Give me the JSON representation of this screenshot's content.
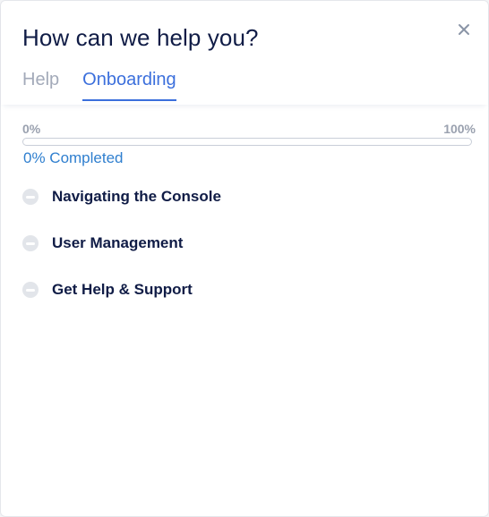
{
  "dialog": {
    "title": "How can we help you?",
    "close_icon": "close-icon"
  },
  "tabs": [
    {
      "label": "Help",
      "active": false
    },
    {
      "label": "Onboarding",
      "active": true
    }
  ],
  "progress": {
    "min_label": "0%",
    "max_label": "100%",
    "value_fraction": 0,
    "status_text": "0% Completed"
  },
  "checklist": [
    {
      "label": "Navigating the Console",
      "icon": "minus-circle-icon"
    },
    {
      "label": "User Management",
      "icon": "minus-circle-icon"
    },
    {
      "label": "Get Help & Support",
      "icon": "minus-circle-icon"
    }
  ],
  "colors": {
    "title": "#101c46",
    "accent": "#3b6fdc",
    "progress_text": "#2f7fcf",
    "inactive_tab": "#a3aab9"
  }
}
